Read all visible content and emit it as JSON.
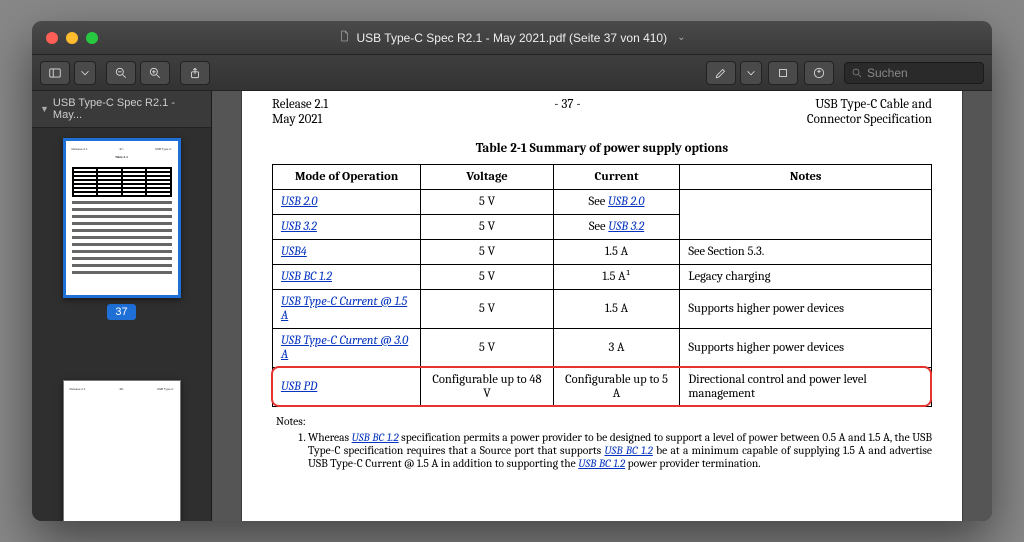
{
  "window": {
    "title": "USB Type-C Spec R2.1 - May 2021.pdf (Seite 37 von 410)"
  },
  "toolbar": {
    "search_placeholder": "Suchen"
  },
  "sidebar": {
    "header": "USB Type-C Spec R2.1 - May...",
    "current_page_badge": "37"
  },
  "document": {
    "header_left_line1": "Release 2.1",
    "header_left_line2": "May 2021",
    "header_center": "- 37 -",
    "header_right_line1": "USB Type-C Cable and",
    "header_right_line2": "Connector Specification",
    "table_caption": "Table 2-1  Summary of power supply options",
    "columns": {
      "c1": "Mode of Operation",
      "c2": "Voltage",
      "c3": "Current",
      "c4": "Notes"
    },
    "rows": {
      "r1": {
        "mode": "USB 2.0",
        "voltage": "5 V",
        "current_prefix": "See ",
        "current_link": "USB 2.0",
        "notes": ""
      },
      "r2": {
        "mode": "USB 3.2",
        "voltage": "5 V",
        "current_prefix": "See ",
        "current_link": "USB 3.2",
        "notes": ""
      },
      "r3": {
        "mode": "USB4",
        "voltage": "5 V",
        "current": "1.5 A",
        "notes": "See Section 5.3."
      },
      "r4": {
        "mode": "USB BC 1.2",
        "voltage": "5 V",
        "current": "1.5 A¹",
        "notes": "Legacy charging"
      },
      "r5": {
        "mode": "USB Type-C Current @ 1.5 A",
        "voltage": "5 V",
        "current": "1.5 A",
        "notes": "Supports higher power devices"
      },
      "r6": {
        "mode": "USB Type-C Current @ 3.0 A",
        "voltage": "5 V",
        "current": "3 A",
        "notes": "Supports higher power devices"
      },
      "r7": {
        "mode": "USB PD",
        "voltage": "Configurable up to 48 V",
        "current": "Configurable up to 5 A",
        "notes": "Directional control and power level management"
      }
    },
    "footnotes_label": "Notes:",
    "footnote1_part1": "Whereas ",
    "footnote1_link1": "USB BC 1.2",
    "footnote1_part2": " specification permits a power provider to be designed to support a level of power between 0.5 A and 1.5 A, the USB Type-C specification requires that a Source port that supports ",
    "footnote1_link2": "USB BC 1.2",
    "footnote1_part3": " be at a minimum capable of supplying 1.5 A and advertise USB Type-C Current @ 1.5 A in addition to supporting the ",
    "footnote1_link3": "USB BC 1.2",
    "footnote1_part4": " power provider termination."
  }
}
